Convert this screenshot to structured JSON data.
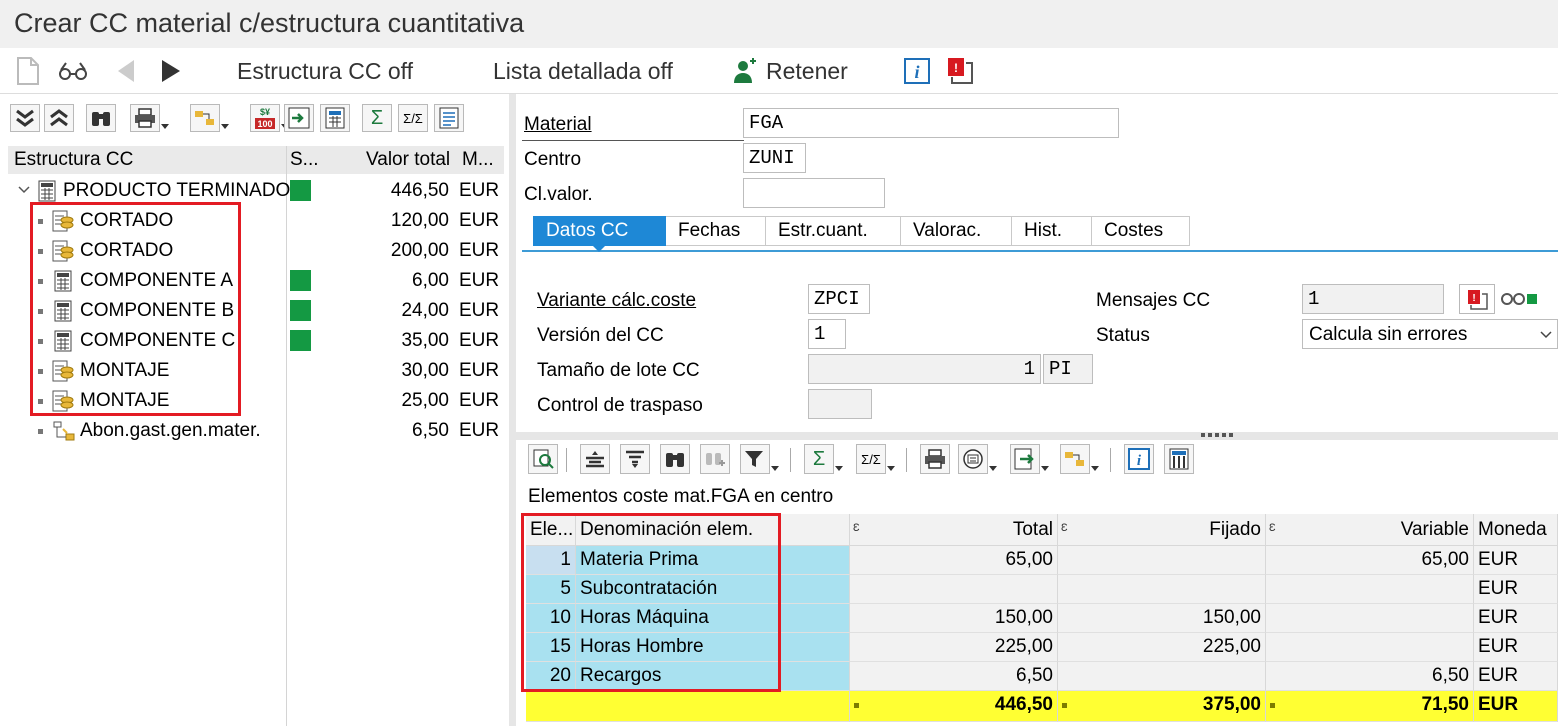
{
  "window": {
    "title": "Crear CC material c/estructura cuantitativa"
  },
  "toolbar": {
    "estructura_off": "Estructura CC off",
    "lista_off": "Lista detallada off",
    "retener": "Retener"
  },
  "tree": {
    "headers": {
      "estructura": "Estructura CC",
      "status": "S...",
      "valor": "Valor total",
      "moneda": "M..."
    },
    "rows": [
      {
        "label": "PRODUCTO TERMINADO",
        "value": "446,50",
        "currency": "EUR",
        "status": true
      },
      {
        "label": "CORTADO",
        "value": "120,00",
        "currency": "EUR",
        "status": false
      },
      {
        "label": "CORTADO",
        "value": "200,00",
        "currency": "EUR",
        "status": false
      },
      {
        "label": "COMPONENTE A",
        "value": "6,00",
        "currency": "EUR",
        "status": true
      },
      {
        "label": "COMPONENTE B",
        "value": "24,00",
        "currency": "EUR",
        "status": true
      },
      {
        "label": "COMPONENTE C",
        "value": "35,00",
        "currency": "EUR",
        "status": true
      },
      {
        "label": "MONTAJE",
        "value": "30,00",
        "currency": "EUR",
        "status": false
      },
      {
        "label": "MONTAJE",
        "value": "25,00",
        "currency": "EUR",
        "status": false
      },
      {
        "label": "Abon.gast.gen.mater.",
        "value": "6,50",
        "currency": "EUR",
        "status": false
      }
    ]
  },
  "header_fields": {
    "material_label": "Material",
    "material_value": "FGA",
    "centro_label": "Centro",
    "centro_value": "ZUNI",
    "clvalor_label": "Cl.valor.",
    "clvalor_value": ""
  },
  "tabs": [
    "Datos CC",
    "Fechas",
    "Estr.cuant.",
    "Valorac.",
    "Hist.",
    "Costes"
  ],
  "datos": {
    "variante_label": "Variante cálc.coste",
    "variante_value": "ZPCI",
    "version_label": "Versión del CC",
    "version_value": "1",
    "lote_label": "Tamaño de lote CC",
    "lote_value": "1",
    "lote_unit": "PI",
    "traspaso_label": "Control de traspaso",
    "traspaso_value": "",
    "mensajes_label": "Mensajes CC",
    "mensajes_value": "1",
    "status_label": "Status",
    "status_value": "Calcula sin errores"
  },
  "grid": {
    "title": "Elementos coste mat.FGA en centro",
    "headers": {
      "ele": "Ele...",
      "denom": "Denominación elem.",
      "total": "Total",
      "fijado": "Fijado",
      "variable": "Variable",
      "moneda": "Moneda"
    },
    "rows": [
      {
        "ele": "1",
        "denom": "Materia Prima",
        "total": "65,00",
        "fijado": "",
        "variable": "65,00",
        "moneda": "EUR"
      },
      {
        "ele": "5",
        "denom": "Subcontratación",
        "total": "",
        "fijado": "",
        "variable": "",
        "moneda": "EUR"
      },
      {
        "ele": "10",
        "denom": "Horas Máquina",
        "total": "150,00",
        "fijado": "150,00",
        "variable": "",
        "moneda": "EUR"
      },
      {
        "ele": "15",
        "denom": "Horas Hombre",
        "total": "225,00",
        "fijado": "225,00",
        "variable": "",
        "moneda": "EUR"
      },
      {
        "ele": "20",
        "denom": "Recargos",
        "total": "6,50",
        "fijado": "",
        "variable": "6,50",
        "moneda": "EUR"
      }
    ],
    "totals": {
      "total": "446,50",
      "fijado": "375,00",
      "variable": "71,50",
      "moneda": "EUR"
    }
  },
  "colors": {
    "accent": "#1e88d6",
    "status_green": "#149943",
    "highlight_red": "#e31b23",
    "selection_blue": "#a9e1f0",
    "total_yellow": "#ffff33"
  }
}
